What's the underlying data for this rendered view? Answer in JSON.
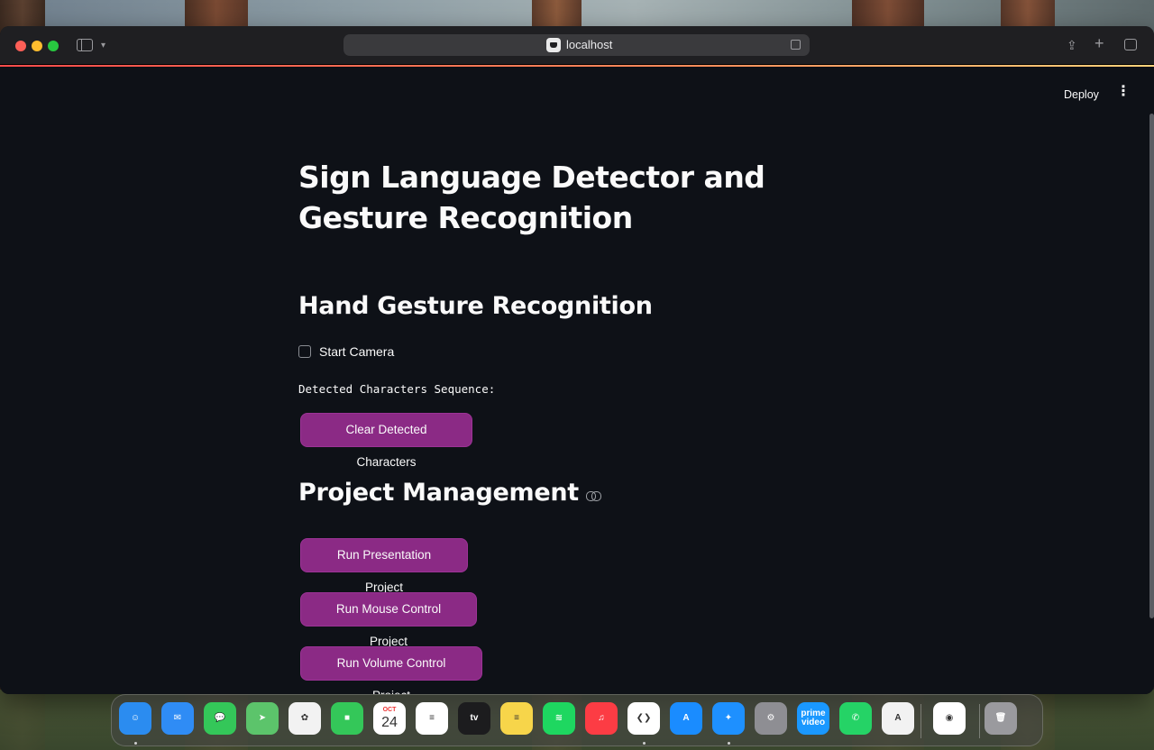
{
  "browser": {
    "url": "localhost"
  },
  "app": {
    "deploy_label": "Deploy",
    "menu_glyph": "⋮",
    "title": "Sign Language Detector and Gesture Recognition",
    "section_gesture": "Hand Gesture Recognition",
    "start_camera_label": "Start Camera",
    "start_camera_checked": false,
    "sequence_label": "Detected Characters Sequence:",
    "clear_button": "Clear Detected Characters",
    "section_project": "Project Management",
    "buttons": {
      "presentation": "Run Presentation Project",
      "mouse": "Run Mouse Control Project",
      "volume": "Run Volume Control Project"
    },
    "accent_color": "#8b2a85",
    "background_color": "#0e1117"
  },
  "dock": {
    "apps": [
      {
        "name": "Finder",
        "color": "#2b8cf0",
        "glyph": "☺"
      },
      {
        "name": "Mail",
        "color": "#2f8cf5",
        "glyph": "✉"
      },
      {
        "name": "Messages",
        "color": "#34c759",
        "glyph": "💬"
      },
      {
        "name": "Maps",
        "color": "#5cc46b",
        "glyph": "➤"
      },
      {
        "name": "Photos",
        "color": "#f2f2f2",
        "glyph": "✿"
      },
      {
        "name": "FaceTime",
        "color": "#34c759",
        "glyph": "■"
      },
      {
        "name": "Calendar",
        "color": "#ffffff",
        "glyph": "24",
        "month": "OCT"
      },
      {
        "name": "Reminders",
        "color": "#ffffff",
        "glyph": "≡"
      },
      {
        "name": "TV",
        "color": "#1c1c1e",
        "glyph": "tv"
      },
      {
        "name": "Notes",
        "color": "#f7d54a",
        "glyph": "≡"
      },
      {
        "name": "Spotify",
        "color": "#1ed760",
        "glyph": "≋"
      },
      {
        "name": "Music",
        "color": "#fc3c44",
        "glyph": "♫"
      },
      {
        "name": "VS Code",
        "color": "#ffffff",
        "glyph": "❮❯"
      },
      {
        "name": "App Store",
        "color": "#1a8cff",
        "glyph": "A"
      },
      {
        "name": "Safari",
        "color": "#1e90ff",
        "glyph": "✦"
      },
      {
        "name": "System Settings",
        "color": "#8e8e93",
        "glyph": "⚙"
      },
      {
        "name": "Prime Video",
        "color": "#1a98ff",
        "glyph": "prime video"
      },
      {
        "name": "WhatsApp",
        "color": "#25d366",
        "glyph": "✆"
      },
      {
        "name": "Xcode Instruments",
        "color": "#f2f2f2",
        "glyph": "A"
      },
      {
        "name": "Chrome",
        "color": "#ffffff",
        "glyph": "◉"
      },
      {
        "name": "Trash",
        "color": "#9a9a9e",
        "glyph": "🗑"
      }
    ]
  }
}
